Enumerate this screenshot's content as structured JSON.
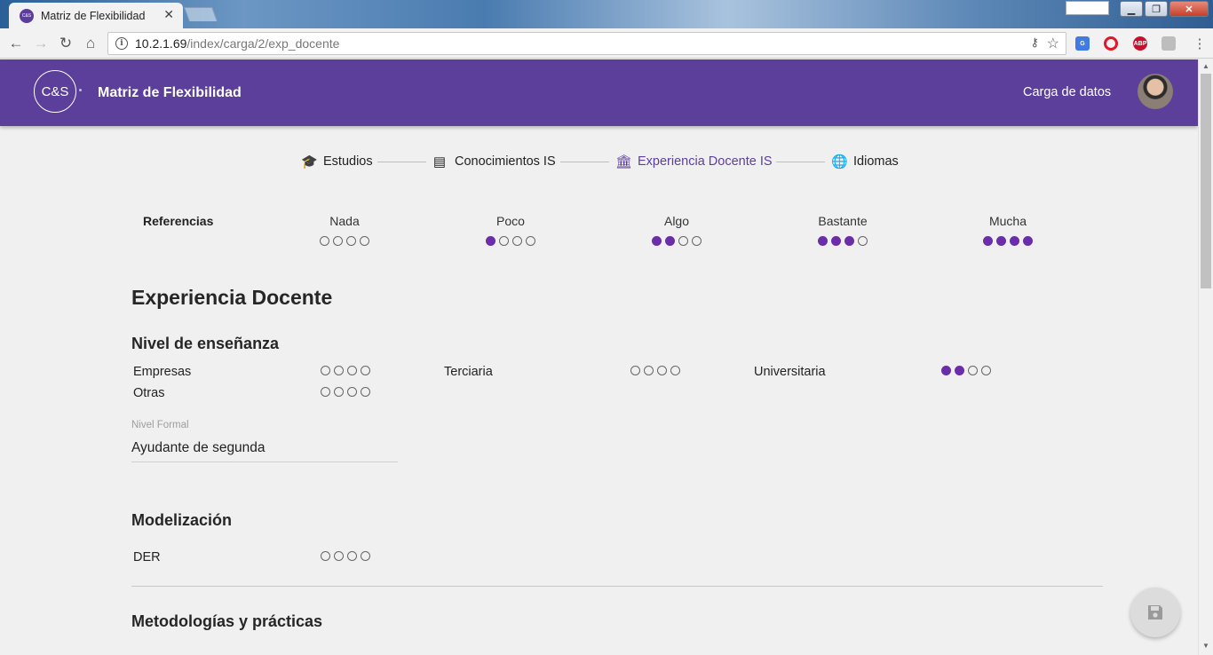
{
  "browser": {
    "tab_title": "Matriz de Flexibilidad",
    "tab_close": "✕",
    "favicon_text": "C&S",
    "url_host": "10.2.1.69",
    "url_path": "/index/carga/2/exp_docente"
  },
  "header": {
    "logo_text": "C&S",
    "title": "Matriz de Flexibilidad",
    "action_label": "Carga de datos"
  },
  "stepper": [
    {
      "label": "Estudios",
      "icon": "graduation-cap-icon",
      "glyph": "🎓",
      "active": false
    },
    {
      "label": "Conocimientos IS",
      "icon": "message-icon",
      "glyph": "▤",
      "active": false
    },
    {
      "label": "Experiencia Docente IS",
      "icon": "bank-icon",
      "glyph": "🏛",
      "active": true
    },
    {
      "label": "Idiomas",
      "icon": "globe-icon",
      "glyph": "🌐",
      "active": false
    }
  ],
  "references": {
    "label": "Referencias",
    "levels": [
      {
        "name": "Nada",
        "filled": 0
      },
      {
        "name": "Poco",
        "filled": 1
      },
      {
        "name": "Algo",
        "filled": 2
      },
      {
        "name": "Bastante",
        "filled": 3
      },
      {
        "name": "Mucha",
        "filled": 4
      }
    ]
  },
  "main": {
    "title": "Experiencia Docente",
    "nivel": {
      "heading": "Nivel de enseñanza",
      "items": [
        {
          "label": "Empresas",
          "filled": 0
        },
        {
          "label": "Terciaria",
          "filled": 0
        },
        {
          "label": "Universitaria",
          "filled": 2
        },
        {
          "label": "Otras",
          "filled": 0
        }
      ],
      "formal_label": "Nivel Formal",
      "formal_value": "Ayudante de segunda"
    },
    "modelizacion": {
      "heading": "Modelización",
      "items": [
        {
          "label": "DER",
          "filled": 0
        }
      ]
    },
    "metodologias": {
      "heading": "Metodologías y prácticas"
    }
  },
  "colors": {
    "primary": "#5c3f9b",
    "dot_filled": "#6a2ea8"
  }
}
